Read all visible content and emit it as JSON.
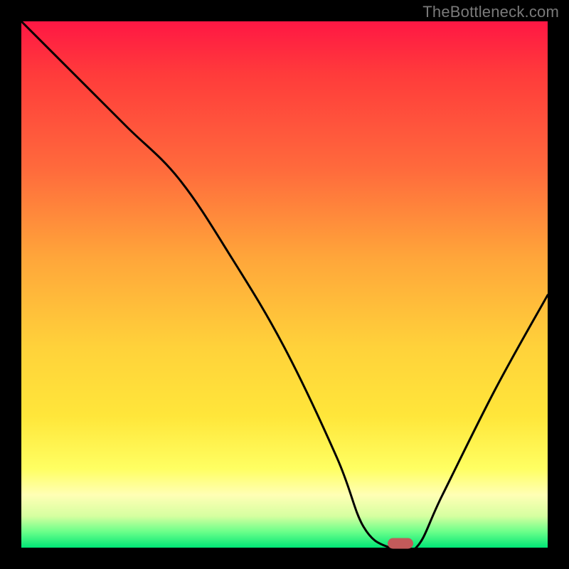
{
  "watermark": "TheBottleneck.com",
  "chart_data": {
    "type": "line",
    "title": "",
    "xlabel": "",
    "ylabel": "",
    "xlim": [
      0,
      100
    ],
    "ylim": [
      0,
      100
    ],
    "grid": false,
    "legend": false,
    "x": [
      0,
      10,
      20,
      30,
      40,
      50,
      60,
      65,
      70,
      75,
      80,
      90,
      100
    ],
    "values": [
      100,
      90,
      80,
      70,
      55,
      38,
      17,
      4,
      0,
      0,
      10,
      30,
      48
    ],
    "marker": {
      "x": 72,
      "y": 0,
      "color": "#c25a5a"
    },
    "gradient_stops": [
      {
        "pct": 0,
        "color": "#ff1744"
      },
      {
        "pct": 50,
        "color": "#ffd23a"
      },
      {
        "pct": 90,
        "color": "#ffffb5"
      },
      {
        "pct": 100,
        "color": "#00e676"
      }
    ]
  }
}
